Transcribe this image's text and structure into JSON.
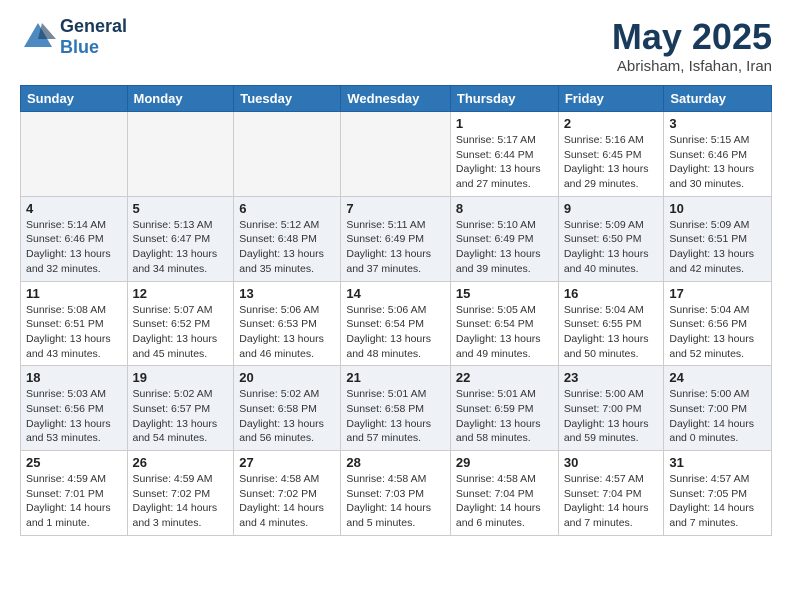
{
  "header": {
    "logo_line1": "General",
    "logo_line2": "Blue",
    "month": "May 2025",
    "location": "Abrisham, Isfahan, Iran"
  },
  "weekdays": [
    "Sunday",
    "Monday",
    "Tuesday",
    "Wednesday",
    "Thursday",
    "Friday",
    "Saturday"
  ],
  "weeks": [
    [
      {
        "day": "",
        "info": ""
      },
      {
        "day": "",
        "info": ""
      },
      {
        "day": "",
        "info": ""
      },
      {
        "day": "",
        "info": ""
      },
      {
        "day": "1",
        "info": "Sunrise: 5:17 AM\nSunset: 6:44 PM\nDaylight: 13 hours\nand 27 minutes."
      },
      {
        "day": "2",
        "info": "Sunrise: 5:16 AM\nSunset: 6:45 PM\nDaylight: 13 hours\nand 29 minutes."
      },
      {
        "day": "3",
        "info": "Sunrise: 5:15 AM\nSunset: 6:46 PM\nDaylight: 13 hours\nand 30 minutes."
      }
    ],
    [
      {
        "day": "4",
        "info": "Sunrise: 5:14 AM\nSunset: 6:46 PM\nDaylight: 13 hours\nand 32 minutes."
      },
      {
        "day": "5",
        "info": "Sunrise: 5:13 AM\nSunset: 6:47 PM\nDaylight: 13 hours\nand 34 minutes."
      },
      {
        "day": "6",
        "info": "Sunrise: 5:12 AM\nSunset: 6:48 PM\nDaylight: 13 hours\nand 35 minutes."
      },
      {
        "day": "7",
        "info": "Sunrise: 5:11 AM\nSunset: 6:49 PM\nDaylight: 13 hours\nand 37 minutes."
      },
      {
        "day": "8",
        "info": "Sunrise: 5:10 AM\nSunset: 6:49 PM\nDaylight: 13 hours\nand 39 minutes."
      },
      {
        "day": "9",
        "info": "Sunrise: 5:09 AM\nSunset: 6:50 PM\nDaylight: 13 hours\nand 40 minutes."
      },
      {
        "day": "10",
        "info": "Sunrise: 5:09 AM\nSunset: 6:51 PM\nDaylight: 13 hours\nand 42 minutes."
      }
    ],
    [
      {
        "day": "11",
        "info": "Sunrise: 5:08 AM\nSunset: 6:51 PM\nDaylight: 13 hours\nand 43 minutes."
      },
      {
        "day": "12",
        "info": "Sunrise: 5:07 AM\nSunset: 6:52 PM\nDaylight: 13 hours\nand 45 minutes."
      },
      {
        "day": "13",
        "info": "Sunrise: 5:06 AM\nSunset: 6:53 PM\nDaylight: 13 hours\nand 46 minutes."
      },
      {
        "day": "14",
        "info": "Sunrise: 5:06 AM\nSunset: 6:54 PM\nDaylight: 13 hours\nand 48 minutes."
      },
      {
        "day": "15",
        "info": "Sunrise: 5:05 AM\nSunset: 6:54 PM\nDaylight: 13 hours\nand 49 minutes."
      },
      {
        "day": "16",
        "info": "Sunrise: 5:04 AM\nSunset: 6:55 PM\nDaylight: 13 hours\nand 50 minutes."
      },
      {
        "day": "17",
        "info": "Sunrise: 5:04 AM\nSunset: 6:56 PM\nDaylight: 13 hours\nand 52 minutes."
      }
    ],
    [
      {
        "day": "18",
        "info": "Sunrise: 5:03 AM\nSunset: 6:56 PM\nDaylight: 13 hours\nand 53 minutes."
      },
      {
        "day": "19",
        "info": "Sunrise: 5:02 AM\nSunset: 6:57 PM\nDaylight: 13 hours\nand 54 minutes."
      },
      {
        "day": "20",
        "info": "Sunrise: 5:02 AM\nSunset: 6:58 PM\nDaylight: 13 hours\nand 56 minutes."
      },
      {
        "day": "21",
        "info": "Sunrise: 5:01 AM\nSunset: 6:58 PM\nDaylight: 13 hours\nand 57 minutes."
      },
      {
        "day": "22",
        "info": "Sunrise: 5:01 AM\nSunset: 6:59 PM\nDaylight: 13 hours\nand 58 minutes."
      },
      {
        "day": "23",
        "info": "Sunrise: 5:00 AM\nSunset: 7:00 PM\nDaylight: 13 hours\nand 59 minutes."
      },
      {
        "day": "24",
        "info": "Sunrise: 5:00 AM\nSunset: 7:00 PM\nDaylight: 14 hours\nand 0 minutes."
      }
    ],
    [
      {
        "day": "25",
        "info": "Sunrise: 4:59 AM\nSunset: 7:01 PM\nDaylight: 14 hours\nand 1 minute."
      },
      {
        "day": "26",
        "info": "Sunrise: 4:59 AM\nSunset: 7:02 PM\nDaylight: 14 hours\nand 3 minutes."
      },
      {
        "day": "27",
        "info": "Sunrise: 4:58 AM\nSunset: 7:02 PM\nDaylight: 14 hours\nand 4 minutes."
      },
      {
        "day": "28",
        "info": "Sunrise: 4:58 AM\nSunset: 7:03 PM\nDaylight: 14 hours\nand 5 minutes."
      },
      {
        "day": "29",
        "info": "Sunrise: 4:58 AM\nSunset: 7:04 PM\nDaylight: 14 hours\nand 6 minutes."
      },
      {
        "day": "30",
        "info": "Sunrise: 4:57 AM\nSunset: 7:04 PM\nDaylight: 14 hours\nand 7 minutes."
      },
      {
        "day": "31",
        "info": "Sunrise: 4:57 AM\nSunset: 7:05 PM\nDaylight: 14 hours\nand 7 minutes."
      }
    ]
  ]
}
